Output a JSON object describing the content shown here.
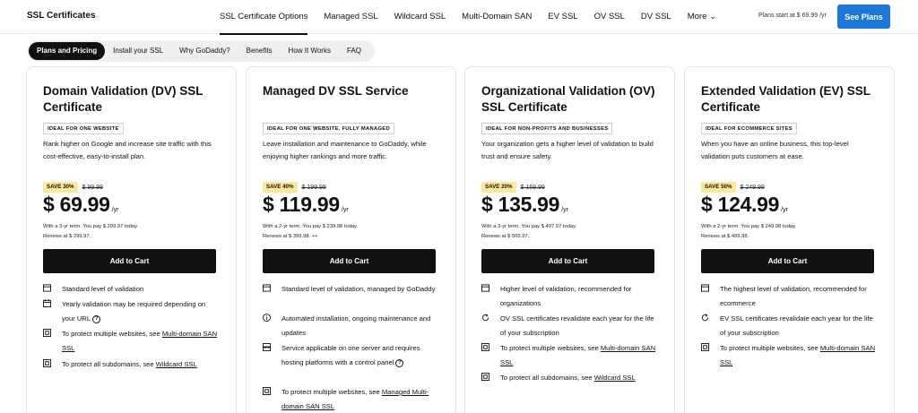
{
  "brand": "SSL Certificates",
  "nav": {
    "links": [
      "SSL Certificate Options",
      "Managed SSL",
      "Wildcard SSL",
      "Multi-Domain SAN",
      "EV SSL",
      "OV SSL",
      "DV SSL",
      "More"
    ],
    "plans_start": "Plans start at $ 69.99 /yr",
    "see_plans": "See Plans"
  },
  "subnav": [
    "Plans and Pricing",
    "Install your SSL",
    "Why GoDaddy?",
    "Benefits",
    "How It Works",
    "FAQ"
  ],
  "cards": [
    {
      "title": "Domain Validation (DV) SSL Certificate",
      "ideal": "IDEAL FOR ONE WEBSITE",
      "desc": "Rank higher on Google and increase site traffic with this cost-effective, easy-to-install plan.",
      "save": "SAVE 30%",
      "old_price": "$ 99.99",
      "price": "$ 69.99",
      "per": "/yr",
      "term": "With a 3-yr term. You pay $ 209.97 today.",
      "renew": "Renews at $ 299.97.",
      "cart": "Add to Cart",
      "features": [
        {
          "icon": "certificate-icon",
          "text": "Standard level of validation"
        },
        {
          "icon": "calendar-icon",
          "text": "Yearly validation may be required depending on your URL"
        },
        {
          "icon": "multi-site-icon",
          "pre": "To protect multiple websites, see ",
          "link": "Multi-domain SAN SSL"
        },
        {
          "icon": "multi-site-icon",
          "pre": "To protect all subdomains, see ",
          "link": "Wildcard SSL"
        }
      ]
    },
    {
      "title": "Managed DV SSL Service",
      "ideal": "IDEAL FOR ONE WEBSITE, FULLY MANAGED",
      "desc": "Leave installation and maintenance to GoDaddy, while enjoying higher rankings and more traffic.",
      "save": "SAVE 40%",
      "old_price": "$ 199.99",
      "price": "$ 119.99",
      "per": "/yr",
      "term": "With a 2-yr term. You pay $ 239.98 today.",
      "renew": "Renews at $ 399.98. ++",
      "cart": "Add to Cart",
      "features": [
        {
          "icon": "certificate-icon",
          "text": "Standard level of validation, managed by GoDaddy"
        },
        {
          "icon": "info-circle-icon",
          "text": "Automated installation, ongoing maintenance and updates"
        },
        {
          "icon": "server-icon",
          "text": "Service applicable on one server and requires hosting platforms with a control panel"
        },
        {
          "icon": "multi-site-icon",
          "pre": "To protect multiple websites, see ",
          "link": "Managed Multi-domain SAN SSL"
        }
      ]
    },
    {
      "title": "Organizational Validation (OV) SSL Certificate",
      "ideal": "IDEAL FOR NON-PROFITS AND BUSINESSES",
      "desc": "Your organization gets a higher level of validation to build trust and ensure safety.",
      "save": "SAVE 20%",
      "old_price": "$ 169.99",
      "price": "$ 135.99",
      "per": "/yr",
      "term": "With a 3-yr term. You pay $ 407.97 today.",
      "renew": "Renews at $ 509.97.",
      "cart": "Add to Cart",
      "features": [
        {
          "icon": "certificate-icon",
          "text": "Higher level of validation, recommended for organizations"
        },
        {
          "icon": "refresh-icon",
          "text": "OV SSL certificates revalidate each year for the life of your subscription"
        },
        {
          "icon": "multi-site-icon",
          "pre": "To protect multiple websites, see ",
          "link": "Multi-domain SAN SSL"
        },
        {
          "icon": "multi-site-icon",
          "pre": "To protect all subdomains, see ",
          "link": "Wildcard SSL"
        }
      ]
    },
    {
      "title": "Extended Validation (EV) SSL Certificate",
      "ideal": "IDEAL FOR ECOMMERCE SITES",
      "desc": "When you have an online business, this top-level validation puts customers at ease.",
      "save": "SAVE 50%",
      "old_price": "$ 249.99",
      "price": "$ 124.99",
      "per": "/yr",
      "term": "With a 2-yr term. You pay $ 249.98 today.",
      "renew": "Renews at $ 499.98.",
      "cart": "Add to Cart",
      "features": [
        {
          "icon": "certificate-icon",
          "text": "The highest level of validation, recommended for ecommerce"
        },
        {
          "icon": "refresh-icon",
          "text": "EV SSL certificates revalidate each year for the life of your subscription"
        },
        {
          "icon": "multi-site-icon",
          "pre": "To protect multiple websites, see ",
          "link": "Multi-domain SAN SSL"
        }
      ]
    }
  ],
  "colors": {
    "accent": "#1c78d4",
    "save_badge": "#fbe89a",
    "button": "#111111"
  }
}
